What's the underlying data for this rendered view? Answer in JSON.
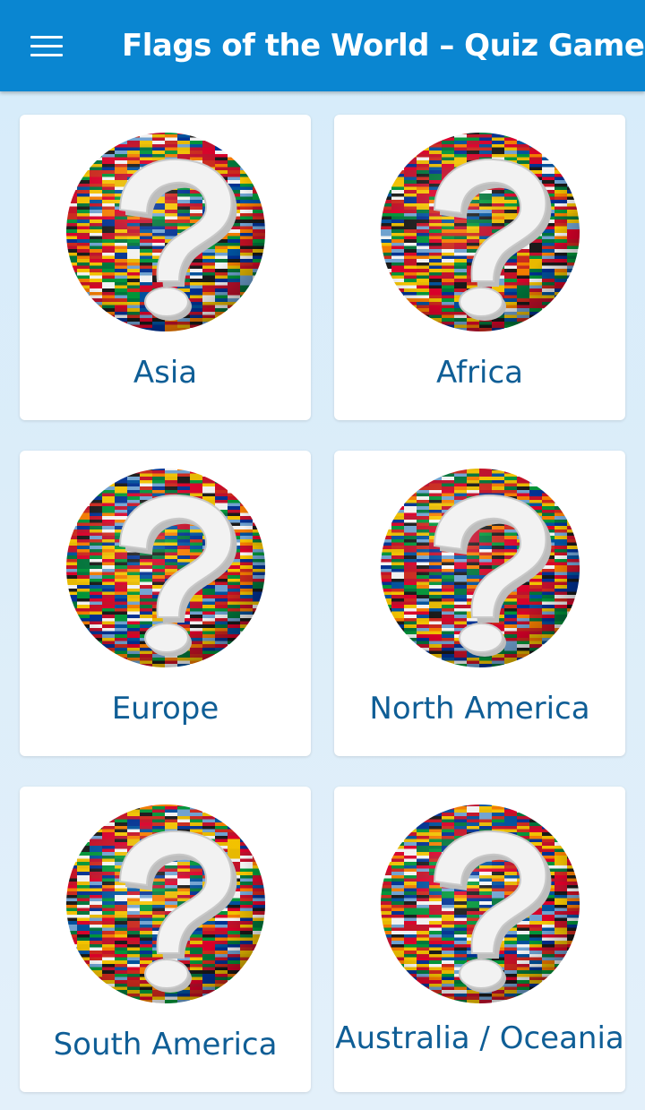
{
  "appbar": {
    "title": "Flags of the World – Quiz Game",
    "menu_icon": "hamburger-menu-icon",
    "background": "#0a86d1"
  },
  "categories": [
    {
      "label": "Asia",
      "icon": "flag-globe-question-icon"
    },
    {
      "label": "Africa",
      "icon": "flag-globe-question-icon"
    },
    {
      "label": "Europe",
      "icon": "flag-globe-question-icon"
    },
    {
      "label": "North America",
      "icon": "flag-globe-question-icon"
    },
    {
      "label": "South America",
      "icon": "flag-globe-question-icon"
    },
    {
      "label": "Australia / Oceania",
      "icon": "flag-globe-question-icon"
    }
  ],
  "colors": {
    "label_text": "#0f5e96",
    "card_background": "#ffffff",
    "page_background": "#d6ecfa"
  }
}
